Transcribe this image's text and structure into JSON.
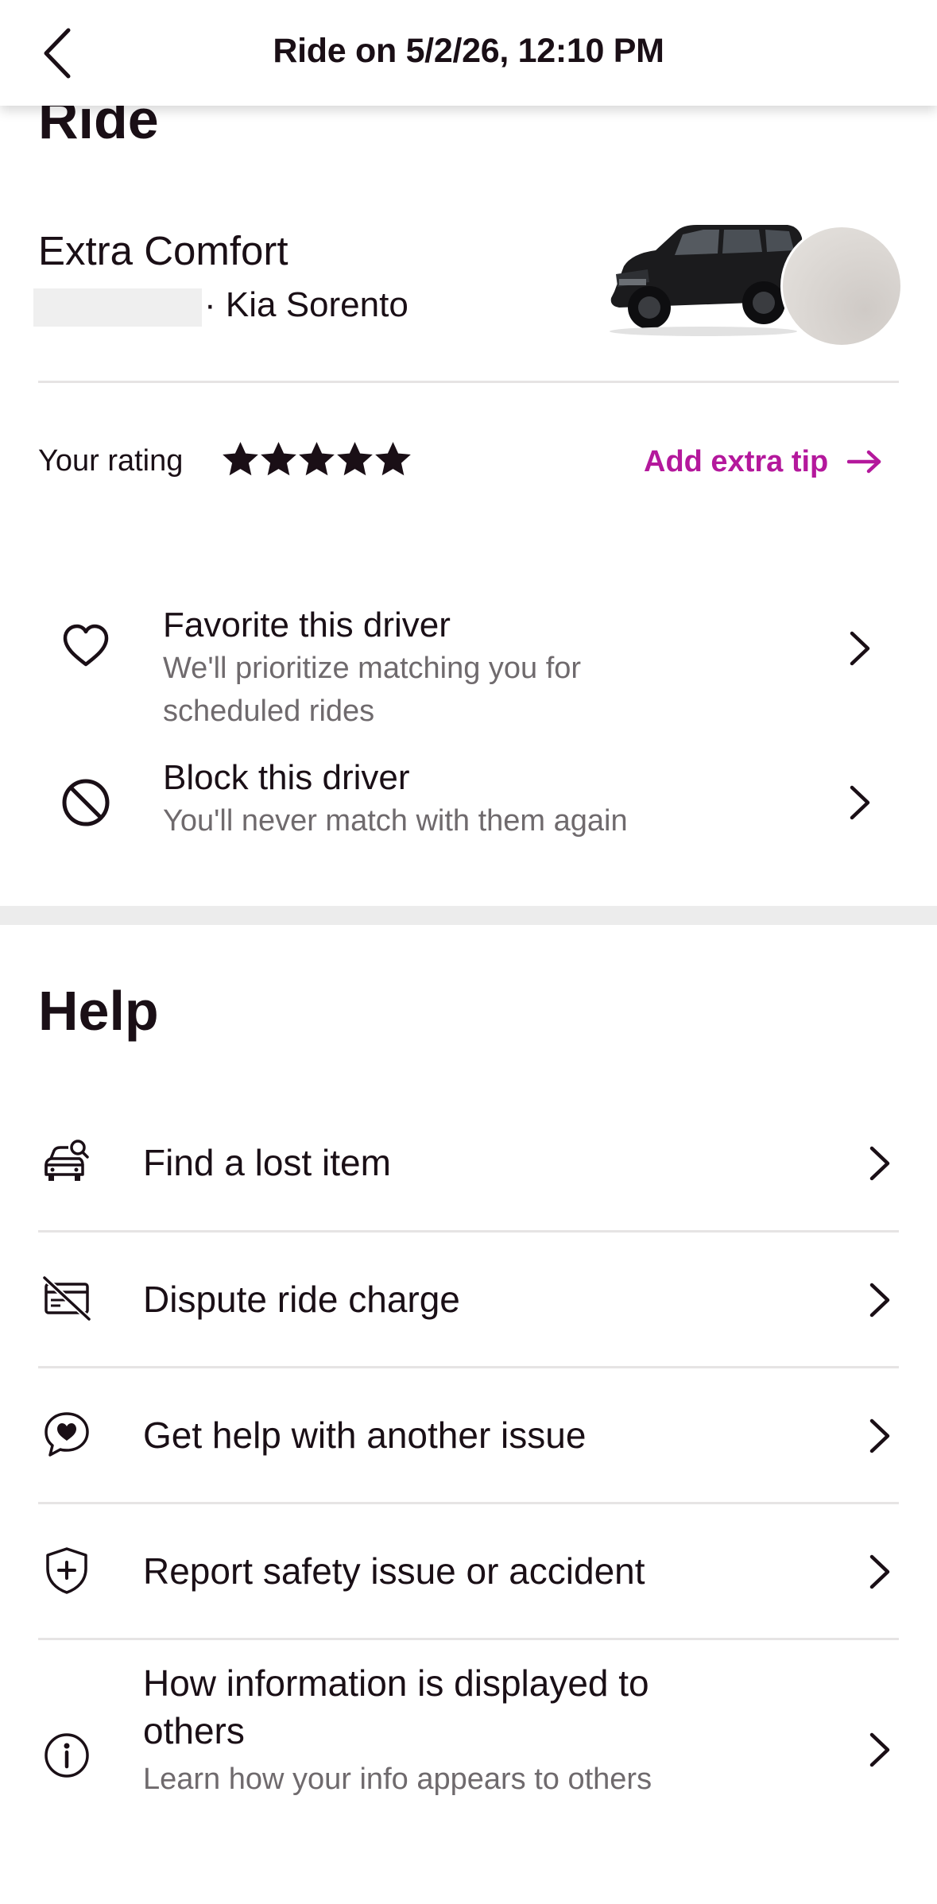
{
  "header": {
    "title": "Ride on 5/2/26, 12:10 PM",
    "back_icon": "chevron-left-icon"
  },
  "ride": {
    "heading": "Ride",
    "service": "Extra Comfort",
    "vehicle": "· Kia Sorento",
    "rating_label": "Your rating",
    "rating_stars": 5,
    "rating_max": 5,
    "tip_link": "Add extra tip",
    "accent_color": "#b4189c",
    "actions": [
      {
        "title": "Favorite this driver",
        "subtitle": "We'll prioritize matching you for scheduled rides",
        "icon": "heart-icon"
      },
      {
        "title": "Block this driver",
        "subtitle": "You'll never match with them again",
        "icon": "block-icon"
      }
    ]
  },
  "help": {
    "heading": "Help",
    "items": [
      {
        "label": "Find a lost item",
        "icon": "car-search-icon"
      },
      {
        "label": "Dispute ride charge",
        "icon": "card-slash-icon"
      },
      {
        "label": "Get help with another issue",
        "icon": "chat-heart-icon"
      },
      {
        "label": "Report safety issue or accident",
        "icon": "shield-plus-icon"
      },
      {
        "label": "How information is displayed to others",
        "subtitle": "Learn how your info appears to others",
        "icon": "info-icon"
      }
    ]
  }
}
